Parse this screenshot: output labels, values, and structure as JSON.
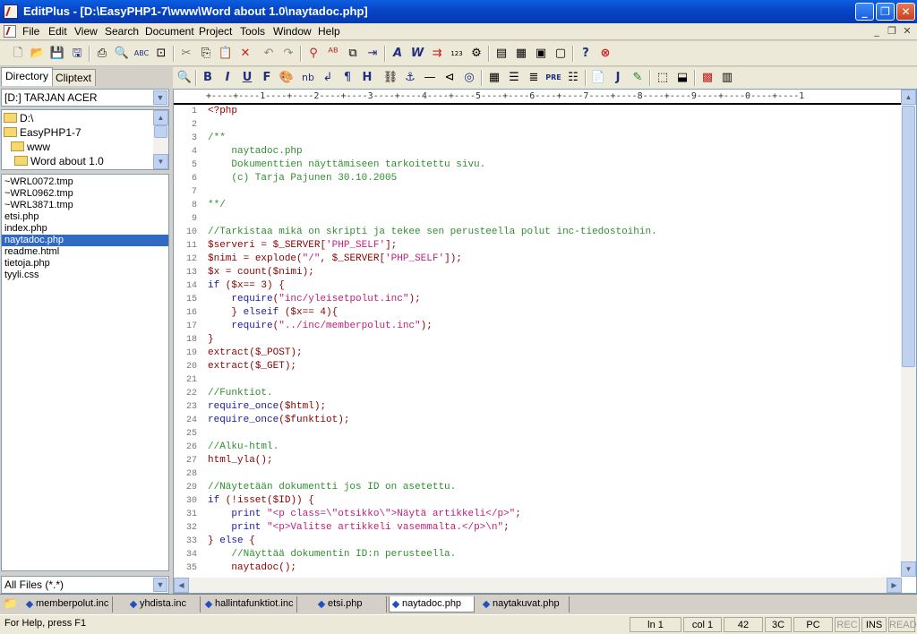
{
  "window": {
    "title": "EditPlus - [D:\\EasyPHP1-7\\www\\Word about 1.0\\naytadoc.php]",
    "min_glyph": "_",
    "max_glyph": "❐",
    "close_glyph": "✕",
    "mdi_min": "_",
    "mdi_restore": "❐",
    "mdi_close": "✕"
  },
  "menu": [
    "File",
    "Edit",
    "View",
    "Search",
    "Document",
    "Project",
    "Tools",
    "Window",
    "Help"
  ],
  "toolbar": {
    "bold": "B",
    "italic": "I",
    "underline": "U",
    "font": "F",
    "nbsp": "nb",
    "br": "↲",
    "para": "¶",
    "heading": "H",
    "pre": "PRE",
    "java": "J",
    "abc": "ABC"
  },
  "sidebar": {
    "tabs": [
      "Directory",
      "Cliptext"
    ],
    "drive": "[D:] TARJAN ACER",
    "tree": [
      "D:\\",
      "EasyPHP1-7",
      "www",
      "Word about 1.0"
    ],
    "files": [
      "~WRL0072.tmp",
      "~WRL0962.tmp",
      "~WRL3871.tmp",
      "etsi.php",
      "index.php",
      "naytadoc.php",
      "readme.html",
      "tietoja.php",
      "tyyli.css"
    ],
    "selected_file": "naytadoc.php",
    "filter": "All Files (*.*)"
  },
  "editor": {
    "ruler": "+----+----1----+----2----+----3----+----4----+----5----+----6----+----7----+----8----+----9----+----0----+----1",
    "lines": [
      "<?php",
      "",
      "/**",
      "    naytadoc.php",
      "    Dokumenttien näyttämiseen tarkoitettu sivu.",
      "    (c) Tarja Pajunen 30.10.2005",
      "",
      "**/",
      "",
      "//Tarkistaa mikä on skripti ja tekee sen perusteella polut inc-tiedostoihin.",
      "$serveri = $_SERVER['PHP_SELF'];",
      "$nimi = explode(\"/\", $_SERVER['PHP_SELF']);",
      "$x = count($nimi);",
      "if ($x== 3) {",
      "    require(\"inc/yleisetpolut.inc\");",
      "    } elseif ($x== 4){",
      "    require(\"../inc/memberpolut.inc\");",
      "}",
      "extract($_POST);",
      "extract($_GET);",
      "",
      "//Funktiot.",
      "require_once($html);",
      "require_once($funktiot);",
      "",
      "//Alku-html.",
      "html_yla();",
      "",
      "//Näytetään dokumentti jos ID on asetettu.",
      "if (!isset($ID)) {",
      "    print \"<p class=\\\"otsikko\\\">Näytä artikkeli</p>\";",
      "    print \"<p>Valitse artikkeli vasemmalta.</p>\\n\";",
      "} else {",
      "    //Näyttää dokumentin ID:n perusteella.",
      "    naytadoc();"
    ]
  },
  "open_files": [
    "memberpolut.inc",
    "yhdista.inc",
    "hallintafunktiot.inc",
    "etsi.php",
    "naytadoc.php",
    "naytakuvat.php"
  ],
  "active_file": "naytadoc.php",
  "status": {
    "help": "For Help, press F1",
    "line": "ln 1",
    "col": "col 1",
    "chars": "42",
    "hex": "3C",
    "mode": "PC",
    "rec": "REC",
    "ins": "INS",
    "read": "READ"
  },
  "colors": {
    "comment": "#2f8f2f",
    "string": "#c0207a",
    "keyword": "#1a1aa0",
    "variable": "#8b0000",
    "selection": "#316ac5"
  }
}
